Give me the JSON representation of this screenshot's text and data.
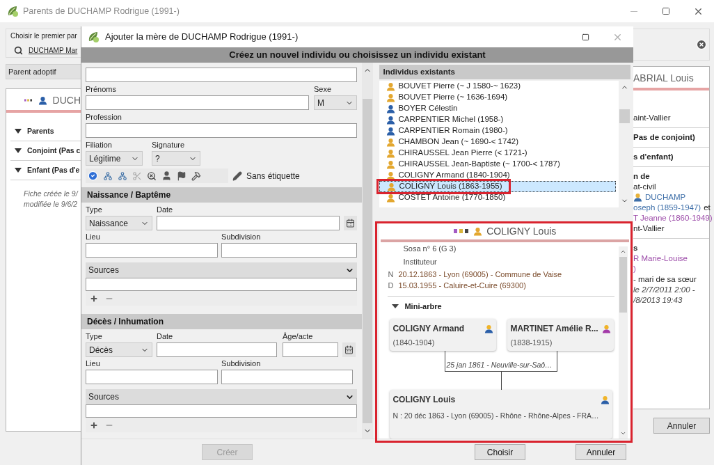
{
  "background_window": {
    "title": "Parents de DUCHAMP Rodrigue (1991-)",
    "first_parent": {
      "label": "Choisir le premier par",
      "link": "DUCHAMP Mar"
    },
    "parent_type": "Parent adoptif",
    "left_card": {
      "name": "DUCH",
      "sections": [
        {
          "label": "Parents",
          "expanded": true
        },
        {
          "label": "Conjoint (Pas c",
          "expanded": true
        },
        {
          "label": "Enfant (Pas d'e",
          "expanded": true
        }
      ],
      "footer": [
        "Fiche créée le 9/",
        "modifiée le 9/6/2"
      ]
    },
    "right_card": {
      "name": "ABRIAL Louis",
      "sections": [
        {
          "lines": [
            {
              "kind": "text",
              "text": "aint-Vallier"
            }
          ]
        },
        {
          "lines": [
            {
              "kind": "heading",
              "text": "Pas de conjoint)"
            }
          ]
        },
        {
          "lines": [
            {
              "kind": "heading",
              "text": "s d'enfant)"
            }
          ]
        },
        {
          "lines": [
            {
              "kind": "heading",
              "text": "n de"
            },
            {
              "kind": "text",
              "text": "at-civil"
            },
            {
              "kind": "person",
              "text": "DUCHAMP",
              "color": "#3d6ea8"
            },
            {
              "kind": "link",
              "text": "oseph (1859-1947)",
              "suffix": "et",
              "color": "#3d6ea8"
            },
            {
              "kind": "link",
              "text": "T Jeanne (1860-1949)",
              "color": "#9b4aa8"
            },
            {
              "kind": "text",
              "text": "nt-Vallier"
            }
          ]
        },
        {
          "lines": [
            {
              "kind": "heading",
              "text": "s"
            },
            {
              "kind": "link",
              "text": "R Marie-Louise",
              "color": "#9b4aa8"
            },
            {
              "kind": "link",
              "text": ")",
              "color": "#9b4aa8"
            },
            {
              "kind": "text",
              "text": "- mari de sa sœur"
            },
            {
              "kind": "italic",
              "text": "le 2/7/2011 2:00 -"
            },
            {
              "kind": "italic",
              "text": "/8/2013 19:43"
            }
          ]
        }
      ]
    },
    "buttons": [
      "Annuler"
    ]
  },
  "dialog": {
    "title": "Ajouter la mère de DUCHAMP Rodrigue (1991-)",
    "banner": "Créez un nouvel individu ou choisissez un individu existant",
    "form": {
      "prenoms_label": "Prénoms",
      "sexe": {
        "label": "Sexe",
        "value": "M"
      },
      "profession_label": "Profession",
      "filiation": {
        "label": "Filiation",
        "value": "Légitime"
      },
      "signature": {
        "label": "Signature",
        "value": "?"
      },
      "tag": "Sans étiquette",
      "events": [
        {
          "title": "Naissance / Baptême",
          "type_label": "Type",
          "type_value": "Naissance",
          "date_label": "Date",
          "place_label": "Lieu",
          "subdivision_label": "Subdivision",
          "sources_label": "Sources"
        },
        {
          "title": "Décès / Inhumation",
          "type_label": "Type",
          "type_value": "Décès",
          "date_label": "Date",
          "age_label": "Âge/acte",
          "place_label": "Lieu",
          "subdivision_label": "Subdivision",
          "sources_label": "Sources"
        }
      ]
    },
    "existing": {
      "title": "Individus existants",
      "items": [
        {
          "name": "BOUVET Pierre (~ J 1580-~ 1623)",
          "color": "#e3a72f",
          "selected": false
        },
        {
          "name": "BOUVET Pierre (~ 1636-1694)",
          "color": "#e3a72f",
          "selected": false
        },
        {
          "name": "BOYER Célestin",
          "color": "#2b5fa8",
          "selected": false
        },
        {
          "name": "CARPENTIER Michel (1958-)",
          "color": "#2b5fa8",
          "selected": false
        },
        {
          "name": "CARPENTIER Romain (1980-)",
          "color": "#2b5fa8",
          "selected": false
        },
        {
          "name": "CHAMBON Jean (~ 1690-< 1742)",
          "color": "#e3a72f",
          "selected": false
        },
        {
          "name": "CHIRAUSSEL Jean Pierre (< 1721-)",
          "color": "#e3a72f",
          "selected": false
        },
        {
          "name": "CHIRAUSSEL Jean-Baptiste (~ 1700-< 1787)",
          "color": "#e3a72f",
          "selected": false
        },
        {
          "name": "COLIGNY Armand (1840-1904)",
          "color": "#e3a72f",
          "selected": false
        },
        {
          "name": "COLIGNY Louis (1863-1955)",
          "color": "#e3a72f",
          "selected": true
        },
        {
          "name": "COSTET Antoine (1770-1850)",
          "color": "#e3a72f",
          "selected": false
        }
      ]
    },
    "detail": {
      "name": "COLIGNY Louis",
      "lines": [
        {
          "kind": "plain",
          "text": "Sosa n° 6 (G 3)"
        },
        {
          "kind": "plain",
          "text": "Instituteur"
        },
        {
          "kind": "event",
          "letter": "N",
          "text": "20.12.1863 - Lyon (69005) - Commune de Vaise"
        },
        {
          "kind": "event",
          "letter": "D",
          "text": "15.03.1955 - Caluire-et-Cuire (69300)"
        }
      ],
      "mini_tree": {
        "label": "Mini-arbre",
        "expanded": true,
        "parents": [
          {
            "name": "COLIGNY Armand",
            "dates": "(1840-1904)",
            "color": "#2b5fa8"
          },
          {
            "name": "MARTINET Amélie R...",
            "dates": "(1838-1915)",
            "color": "#a33aa8"
          }
        ],
        "union": "25 jan 1861 - Neuville-sur-Saô…",
        "child": {
          "name": "COLIGNY Louis",
          "birth": "N : 20 déc 1863 - Lyon (69005) - Rhône - Rhône-Alpes - FRA…",
          "color": "#2b5fa8"
        }
      }
    },
    "buttons": [
      {
        "label": "Créer",
        "disabled": true
      },
      {
        "label": "Choisir",
        "disabled": false
      },
      {
        "label": "Annuler",
        "disabled": false
      }
    ]
  }
}
